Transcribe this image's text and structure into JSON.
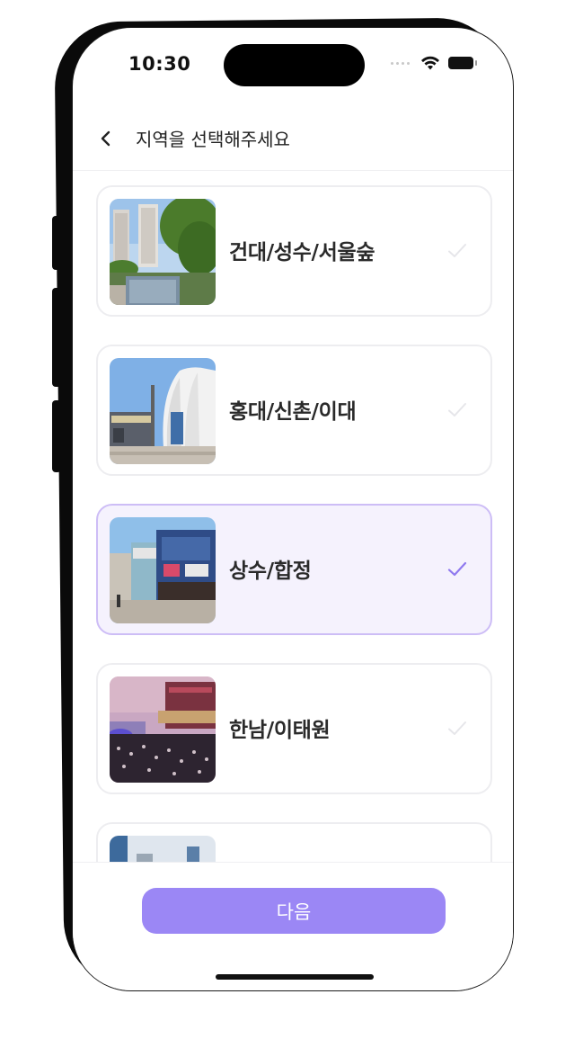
{
  "status_bar": {
    "time": "10:30"
  },
  "header": {
    "title": "지역을 선택해주세요",
    "back_icon": "chevron-left-icon"
  },
  "regions": [
    {
      "label": "건대/성수/서울숲",
      "selected": false
    },
    {
      "label": "홍대/신촌/이대",
      "selected": false
    },
    {
      "label": "상수/합정",
      "selected": true
    },
    {
      "label": "한남/이태원",
      "selected": false
    },
    {
      "label": "",
      "selected": false
    }
  ],
  "footer": {
    "next_label": "다음"
  },
  "colors": {
    "accent": "#9b87f5",
    "selected_bg": "#f5f2fd",
    "selected_border": "#cdbdf6",
    "check_selected": "#8f79ef",
    "check_unselected": "#e6e6ea"
  }
}
